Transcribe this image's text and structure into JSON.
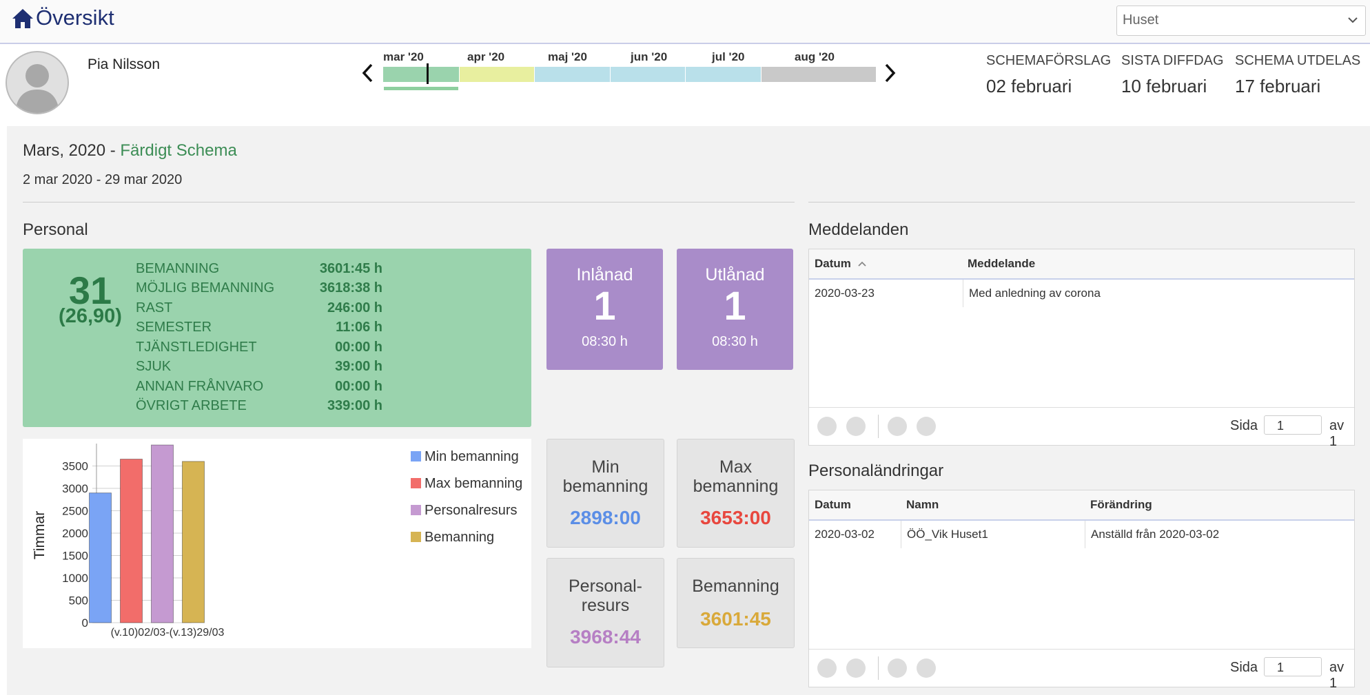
{
  "header": {
    "title": "Översikt",
    "unit_select": "Huset"
  },
  "profile": {
    "name": "Pia Nilsson"
  },
  "timeline": {
    "months": [
      "mar '20",
      "apr '20",
      "maj '20",
      "jun '20",
      "jul '20",
      "aug '20"
    ],
    "prev_icon": "chevron-left-icon",
    "next_icon": "chevron-right-icon",
    "colors": [
      "#9ad3ad",
      "#e8ef9f",
      "#b9e0ea",
      "#b9e0ea",
      "#b9e0ea",
      "#c9c9c9"
    ]
  },
  "schedule": [
    {
      "label": "SCHEMAFÖRSLAG",
      "value": "02 februari"
    },
    {
      "label": "SISTA DIFFDAG",
      "value": "10 februari"
    },
    {
      "label": "SCHEMA UTDELAS",
      "value": "17 februari"
    }
  ],
  "period": {
    "title": "Mars, 2020",
    "separator": " - ",
    "status": "Färdigt Schema",
    "range": "2 mar 2020 - 29 mar 2020"
  },
  "personal": {
    "title": "Personal",
    "count": "31",
    "count_sub": "(26,90)",
    "stats": [
      {
        "label": "BEMANNING",
        "value": "3601:45 h"
      },
      {
        "label": "MÖJLIG BEMANNING",
        "value": "3618:38 h"
      },
      {
        "label": "RAST",
        "value": "246:00 h"
      },
      {
        "label": "SEMESTER",
        "value": "11:06 h"
      },
      {
        "label": "TJÄNSTLEDIGHET",
        "value": "00:00 h"
      },
      {
        "label": "SJUK",
        "value": "39:00 h"
      },
      {
        "label": "ANNAN FRÅNVARO",
        "value": "00:00 h"
      },
      {
        "label": "ÖVRIGT ARBETE",
        "value": "339:00 h"
      }
    ],
    "inlanad": {
      "title": "Inlånad",
      "count": "1",
      "hours": "08:30 h"
    },
    "utlanad": {
      "title": "Utlånad",
      "count": "1",
      "hours": "08:30 h"
    }
  },
  "tiles": {
    "min": {
      "title1": "Min",
      "title2": "bemanning",
      "value": "2898:00",
      "color": "#5b8ee6"
    },
    "max": {
      "title1": "Max",
      "title2": "bemanning",
      "value": "3653:00",
      "color": "#e8473e"
    },
    "resurs": {
      "title1": "Personal-",
      "title2": "resurs",
      "value": "3968:44",
      "color": "#b67fc4"
    },
    "bemanning": {
      "title1": "Bemanning",
      "value": "3601:45",
      "color": "#d9a93a"
    }
  },
  "chart_data": {
    "type": "bar",
    "categories": [
      "(v.10)02/03-(v.13)29/03"
    ],
    "series": [
      {
        "name": "Min bemanning",
        "values": [
          2898
        ],
        "color": "#7aa4f5"
      },
      {
        "name": "Max bemanning",
        "values": [
          3653
        ],
        "color": "#f26d6a"
      },
      {
        "name": "Personalresurs",
        "values": [
          3969
        ],
        "color": "#c59ad1"
      },
      {
        "name": "Bemanning",
        "values": [
          3602
        ],
        "color": "#d6b453"
      }
    ],
    "ylabel": "Timmar",
    "ylim": [
      0,
      4000
    ],
    "yticks": [
      0,
      500,
      1000,
      1500,
      2000,
      2500,
      3000,
      3500
    ],
    "legend": "right"
  },
  "messages": {
    "title": "Meddelanden",
    "columns": [
      "Datum",
      "Meddelande"
    ],
    "rows": [
      {
        "date": "2020-03-23",
        "text": "Med anledning av corona"
      }
    ],
    "pager": {
      "page_label": "Sida",
      "page": "1",
      "of_label": "av 1"
    }
  },
  "changes": {
    "title": "Personaländringar",
    "columns": [
      "Datum",
      "Namn",
      "Förändring"
    ],
    "rows": [
      {
        "date": "2020-03-02",
        "name": "ÖÖ_Vik Huset1",
        "change": "Anställd från 2020-03-02"
      }
    ],
    "pager": {
      "page_label": "Sida",
      "page": "1",
      "of_label": "av 1"
    }
  }
}
